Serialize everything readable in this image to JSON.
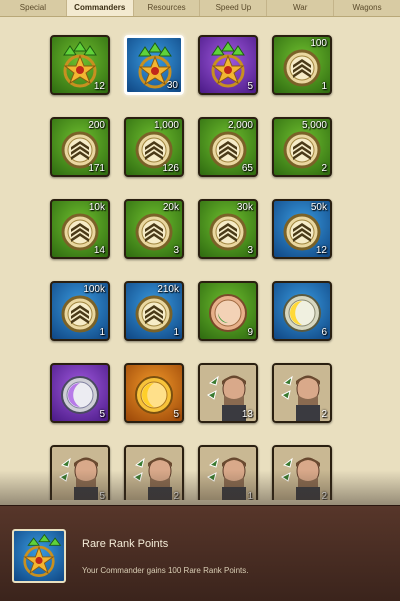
{
  "tabs": [
    {
      "label": "Special"
    },
    {
      "label": "Commanders",
      "active": true
    },
    {
      "label": "Resources"
    },
    {
      "label": "Speed Up"
    },
    {
      "label": "War"
    },
    {
      "label": "Wagons"
    }
  ],
  "items": [
    {
      "bg": "green",
      "icon": "star-wreath-icon",
      "count": "12",
      "req": ""
    },
    {
      "bg": "blue",
      "icon": "star-wreath-icon",
      "count": "30",
      "req": "",
      "selected": true
    },
    {
      "bg": "purple",
      "icon": "star-wreath-icon",
      "count": "5",
      "req": ""
    },
    {
      "bg": "green",
      "icon": "chevron-medal-icon",
      "count": "1",
      "req": "100"
    },
    {
      "bg": "green",
      "icon": "chevron-medal-icon",
      "count": "171",
      "req": "200"
    },
    {
      "bg": "green",
      "icon": "chevron-medal-icon",
      "count": "126",
      "req": "1,000"
    },
    {
      "bg": "green",
      "icon": "chevron-medal-icon",
      "count": "65",
      "req": "2,000"
    },
    {
      "bg": "green",
      "icon": "chevron-medal-icon",
      "count": "2",
      "req": "5,000"
    },
    {
      "bg": "green",
      "icon": "chevron-medal-icon",
      "count": "14",
      "req": "10k"
    },
    {
      "bg": "green",
      "icon": "chevron-medal-icon",
      "count": "3",
      "req": "20k"
    },
    {
      "bg": "green",
      "icon": "chevron-medal-icon",
      "count": "3",
      "req": "30k"
    },
    {
      "bg": "blue",
      "icon": "chevron-medal-icon",
      "count": "12",
      "req": "50k"
    },
    {
      "bg": "blue",
      "icon": "chevron-medal-icon",
      "count": "1",
      "req": "100k"
    },
    {
      "bg": "blue",
      "icon": "chevron-medal-icon",
      "count": "1",
      "req": "210k"
    },
    {
      "bg": "green",
      "icon": "bronze-coin-icon",
      "count": "9",
      "req": ""
    },
    {
      "bg": "blue",
      "icon": "yellow-coin-icon",
      "count": "6",
      "req": ""
    },
    {
      "bg": "purple",
      "icon": "purple-coin-icon",
      "count": "5",
      "req": ""
    },
    {
      "bg": "orange",
      "icon": "orange-coin-icon",
      "count": "5",
      "req": ""
    },
    {
      "bg": "portrait",
      "icon": "commander-portrait-icon",
      "count": "13",
      "req": ""
    },
    {
      "bg": "portrait",
      "icon": "commander-portrait-icon",
      "count": "2",
      "req": ""
    },
    {
      "bg": "portrait",
      "icon": "commander-portrait-icon",
      "count": "5",
      "req": ""
    },
    {
      "bg": "portrait",
      "icon": "commander-portrait-icon",
      "count": "2",
      "req": ""
    },
    {
      "bg": "portrait",
      "icon": "commander-portrait-icon",
      "count": "1",
      "req": ""
    },
    {
      "bg": "portrait",
      "icon": "commander-portrait-icon",
      "count": "2",
      "req": ""
    }
  ],
  "details": {
    "title": "Rare Rank Points",
    "description": "Your Commander gains 100 Rare Rank Points.",
    "icon": "star-wreath-icon"
  }
}
